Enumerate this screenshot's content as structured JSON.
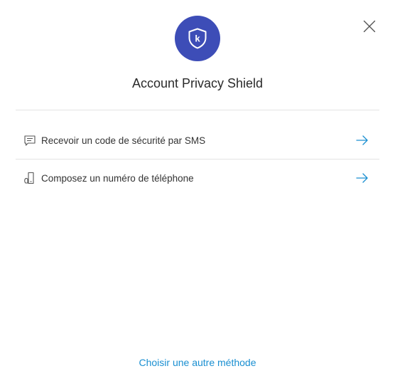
{
  "dialog": {
    "title": "Account Privacy Shield",
    "logo_letter": "k",
    "brand_color": "#3d4db7",
    "accent_color": "#1a8fd1",
    "close_icon": "close-icon"
  },
  "options": [
    {
      "label": "Recevoir un code de sécurité par SMS",
      "icon": "sms-message-icon"
    },
    {
      "label": "Composez un numéro de téléphone",
      "icon": "phone-call-icon"
    }
  ],
  "footer": {
    "link_label": "Choisir une autre méthode"
  }
}
